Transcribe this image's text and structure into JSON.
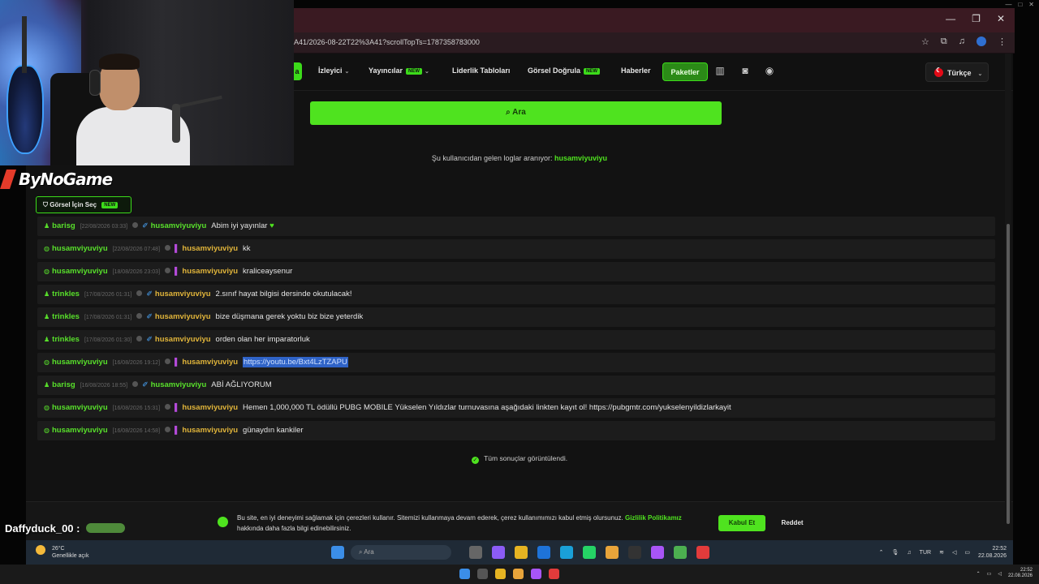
{
  "browser": {
    "url": "A41/2026-08-22T22%3A41?scrollTopTs=1787358783000"
  },
  "nav": {
    "active_fragment": "a",
    "items": [
      {
        "label": "İzleyici",
        "has_chevron": true,
        "new": false
      },
      {
        "label": "Yayıncılar",
        "has_chevron": true,
        "new": true
      },
      {
        "label": "Liderlik Tabloları",
        "has_chevron": false,
        "new": false
      },
      {
        "label": "Görsel Doğrula",
        "has_chevron": false,
        "new": true
      },
      {
        "label": "Haberler",
        "has_chevron": false,
        "new": false
      }
    ],
    "new_badge": "NEW",
    "packages_label": "Paketler",
    "icons": [
      "chart-icon",
      "discord-icon",
      "account-icon"
    ],
    "language": "Türkçe"
  },
  "search": {
    "button_label": "Ara"
  },
  "status": {
    "prefix": "Şu kullanıcıdan gelen loglar aranıyor:",
    "user": "husamviyuviyu"
  },
  "visual_select": {
    "label": "Görsel İçin Seç",
    "badge": "NEW"
  },
  "logs": [
    {
      "channel": "barisg",
      "time": "[22/08/2026 03:33]",
      "mark": "sword",
      "user": "husamviyuviyu",
      "user_color": "green",
      "message": "Abim iyi yayınlar",
      "heart": true,
      "selected": false
    },
    {
      "channel": "husamviyuviyu",
      "time": "[22/08/2026 07:48]",
      "mark": "bar",
      "user": "husamviyuviyu",
      "user_color": "gold",
      "message": "kk",
      "heart": false,
      "selected": false
    },
    {
      "channel": "husamviyuviyu",
      "time": "[18/08/2026 23:03]",
      "mark": "bar",
      "user": "husamviyuviyu",
      "user_color": "gold",
      "message": "kraliceaysenur",
      "heart": false,
      "selected": false
    },
    {
      "channel": "trinkles",
      "time": "[17/08/2026 01:31]",
      "mark": "sword",
      "user": "husamviyuviyu",
      "user_color": "gold",
      "message": "2.sınıf hayat bilgisi dersinde okutulacak!",
      "heart": false,
      "selected": false
    },
    {
      "channel": "trinkles",
      "time": "[17/08/2026 01:31]",
      "mark": "sword",
      "user": "husamviyuviyu",
      "user_color": "gold",
      "message": "bize düşmana gerek yoktu biz bize yeterdik",
      "heart": false,
      "selected": false
    },
    {
      "channel": "trinkles",
      "time": "[17/08/2026 01:30]",
      "mark": "sword",
      "user": "husamviyuviyu",
      "user_color": "gold",
      "message": "orden olan her imparatorluk",
      "heart": false,
      "selected": false
    },
    {
      "channel": "husamviyuviyu",
      "time": "[16/08/2026 19:12]",
      "mark": "bar",
      "user": "husamviyuviyu",
      "user_color": "gold",
      "message": "https://youtu.be/Bxt4LzTZAPU",
      "heart": false,
      "selected": true
    },
    {
      "channel": "barisg",
      "time": "[16/08/2026 18:55]",
      "mark": "sword",
      "user": "husamviyuviyu",
      "user_color": "green",
      "message": "ABİ AĞLIYORUM",
      "heart": false,
      "selected": false
    },
    {
      "channel": "husamviyuviyu",
      "time": "[16/08/2026 15:31]",
      "mark": "bar",
      "user": "husamviyuviyu",
      "user_color": "gold",
      "message": "Hemen 1,000,000 TL ödüllü PUBG MOBILE Yükselen Yıldızlar turnuvasına aşağıdaki linkten kayıt ol! https://pubgmtr.com/yukselenyildizlarkayit",
      "heart": false,
      "selected": false
    },
    {
      "channel": "husamviyuviyu",
      "time": "[16/08/2026 14:58]",
      "mark": "bar",
      "user": "husamviyuviyu",
      "user_color": "gold",
      "message": "günaydın kankiler",
      "heart": false,
      "selected": false
    }
  ],
  "results_done": "Tüm sonuçlar görüntülendi.",
  "cookie": {
    "text": "Bu site, en iyi deneyimi sağlamak için çerezleri kullanır. Sitemizi kullanmaya devam ederek, çerez kullanımımızı kabul etmiş olursunuz.",
    "link": "Gizlilik Politikamız",
    "suffix": "hakkında daha fazla bilgi edinebilirsiniz.",
    "accept": "Kabul Et",
    "reject": "Reddet"
  },
  "taskbar_inner": {
    "temperature": "26°C",
    "weather": "Genellikle açık",
    "search_placeholder": "Ara",
    "lang": "TUR",
    "time": "22:52",
    "date": "22.08.2026"
  },
  "taskbar_outer": {
    "time": "22:52",
    "date": "22.08.2026"
  },
  "overlay": {
    "brand": "ByNoGame",
    "chat_user": "Daffyduck_00 :"
  },
  "colors": {
    "accent": "#4fe31f",
    "gold_user": "#e0b43a",
    "selection": "#2f63c7"
  }
}
